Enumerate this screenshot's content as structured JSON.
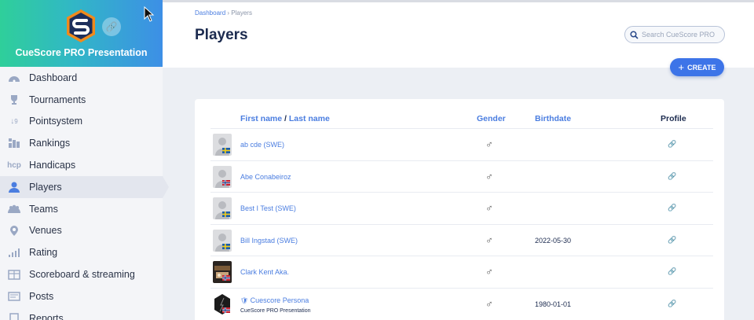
{
  "sidebar": {
    "org_name": "CueScore PRO Presentation",
    "items": [
      {
        "label": "Dashboard",
        "icon": "dashboard-icon"
      },
      {
        "label": "Tournaments",
        "icon": "trophy-icon"
      },
      {
        "label": "Pointsystem",
        "icon": "sort-numeric-icon"
      },
      {
        "label": "Rankings",
        "icon": "rankings-icon"
      },
      {
        "label": "Handicaps",
        "icon": "hcp-icon",
        "icon_text": "hcp"
      },
      {
        "label": "Players",
        "icon": "player-icon",
        "active": true
      },
      {
        "label": "Teams",
        "icon": "teams-icon"
      },
      {
        "label": "Venues",
        "icon": "map-pin-icon"
      },
      {
        "label": "Rating",
        "icon": "rating-icon"
      },
      {
        "label": "Scoreboard & streaming",
        "icon": "scoreboard-icon"
      },
      {
        "label": "Posts",
        "icon": "posts-icon"
      },
      {
        "label": "Reports",
        "icon": "reports-icon"
      }
    ]
  },
  "header": {
    "breadcrumb": {
      "root": "Dashboard",
      "sep": "›",
      "current": "Players"
    },
    "title": "Players",
    "search_placeholder": "Search CueScore PRO"
  },
  "create_label": "CREATE",
  "table": {
    "col_first": "First name",
    "col_sep": "/",
    "col_last": "Last name",
    "col_gender": "Gender",
    "col_birthdate": "Birthdate",
    "col_profile": "Profile",
    "rows": [
      {
        "name": "ab cde (SWE)",
        "gender": "♂",
        "birthdate": "",
        "flag": "SWE",
        "avatar": "placeholder"
      },
      {
        "name": "Abe Conabeiroz",
        "gender": "♂",
        "birthdate": "",
        "flag": "NOR",
        "avatar": "placeholder"
      },
      {
        "name": "Best I Test (SWE)",
        "gender": "♂",
        "birthdate": "",
        "flag": "SWE",
        "avatar": "placeholder"
      },
      {
        "name": "Bill Ingstad (SWE)",
        "gender": "♂",
        "birthdate": "2022-05-30",
        "flag": "SWE",
        "avatar": "placeholder"
      },
      {
        "name": "Clark Kent Aka.",
        "gender": "♂",
        "birthdate": "",
        "flag": "NOR",
        "avatar": "photo"
      },
      {
        "name": "Cuescore Persona",
        "sub": "CueScore PRO Presentation",
        "gender": "♂",
        "birthdate": "1980-01-01",
        "flag": "NOR",
        "avatar": "photo-dark",
        "verified": true
      }
    ]
  },
  "colors": {
    "accent": "#4a7de0",
    "title": "#1c2b4f",
    "create": "#3d74e8"
  }
}
